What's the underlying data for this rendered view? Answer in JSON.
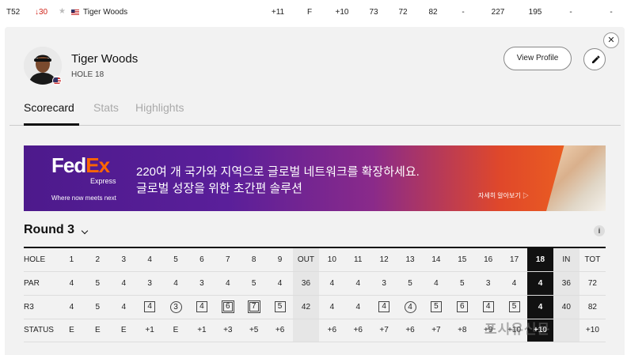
{
  "leaderboard_row": {
    "position": "T52",
    "movement": "↓30",
    "player": "Tiger Woods",
    "to_par": "+11",
    "thru": "F",
    "today": "+10",
    "r1": "73",
    "r2": "72",
    "r3": "82",
    "r4": "-",
    "total": "227",
    "projected": "195",
    "col_a": "-",
    "col_b": "-"
  },
  "player_card": {
    "name": "Tiger Woods",
    "hole_label": "HOLE",
    "hole": "18",
    "view_profile_label": "View Profile",
    "close_glyph": "✕"
  },
  "tabs": [
    {
      "label": "Scorecard",
      "active": true
    },
    {
      "label": "Stats",
      "active": false
    },
    {
      "label": "Highlights",
      "active": false
    }
  ],
  "ad": {
    "logo_fed": "Fed",
    "logo_ex": "Ex",
    "logo_sub": "Express",
    "tagline": "Where now meets next",
    "line1": "220여 개 국가와 지역으로 글로벌 네트워크를 확장하세요.",
    "line2": "글로벌 성장을 위한 초간편 솔루션",
    "cta": "자세히 알아보기 ▷"
  },
  "round": {
    "title": "Round 3",
    "info": "i"
  },
  "scorecard": {
    "holes_row": [
      "HOLE",
      "1",
      "2",
      "3",
      "4",
      "5",
      "6",
      "7",
      "8",
      "9",
      "OUT",
      "10",
      "11",
      "12",
      "13",
      "14",
      "15",
      "16",
      "17",
      "18",
      "IN",
      "TOT"
    ],
    "par_row": [
      "PAR",
      "4",
      "5",
      "4",
      "3",
      "4",
      "3",
      "4",
      "5",
      "4",
      "36",
      "4",
      "4",
      "3",
      "5",
      "4",
      "5",
      "3",
      "4",
      "4",
      "36",
      "72"
    ],
    "r3_row": [
      "R3",
      "4",
      "5",
      "4",
      "4",
      "3",
      "4",
      "6",
      "7",
      "5",
      "42",
      "4",
      "4",
      "4",
      "4",
      "5",
      "6",
      "4",
      "5",
      "4",
      "40",
      "82"
    ],
    "status_row": [
      "STATUS",
      "E",
      "E",
      "E",
      "+1",
      "E",
      "+1",
      "+3",
      "+5",
      "+6",
      "",
      "+6",
      "+6",
      "+7",
      "+6",
      "+7",
      "+8",
      "+9",
      "+10",
      "+10",
      "",
      "+10"
    ]
  },
  "watermark": "포시유신문",
  "colors": {
    "movement_down": "#d1261c",
    "current_hole_bg": "#111111",
    "total_col_bg": "#e6e6e6",
    "fedex_orange": "#ff6600",
    "fedex_purple": "#4d1a8c"
  }
}
